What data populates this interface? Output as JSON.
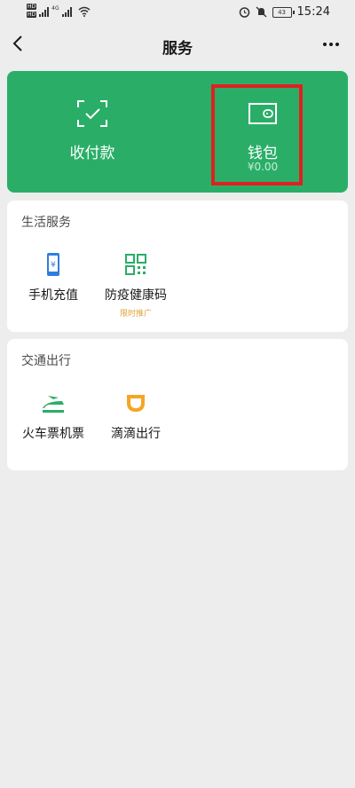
{
  "status_bar": {
    "sim1": "HD",
    "sim2": "HD",
    "network": "4G",
    "battery": "43",
    "time": "15:24"
  },
  "nav": {
    "title": "服务"
  },
  "header_card": {
    "pay_label": "收付款",
    "wallet_label": "钱包",
    "wallet_balance": "¥0.00",
    "color": "#2aae67"
  },
  "life_services": {
    "title": "生活服务",
    "items": [
      {
        "label": "手机充值",
        "icon": "phone-topup-icon",
        "tag": ""
      },
      {
        "label": "防疫健康码",
        "icon": "qr-code-icon",
        "tag": "限时推广"
      }
    ]
  },
  "transport": {
    "title": "交通出行",
    "items": [
      {
        "label": "火车票机票",
        "icon": "train-icon"
      },
      {
        "label": "滴滴出行",
        "icon": "didi-icon"
      }
    ]
  },
  "colors": {
    "highlight_border": "#e02020",
    "accent_green": "#2aae67",
    "promo_orange": "#e0a23a",
    "didi_orange": "#f5a623",
    "phone_blue": "#2f7de1"
  }
}
